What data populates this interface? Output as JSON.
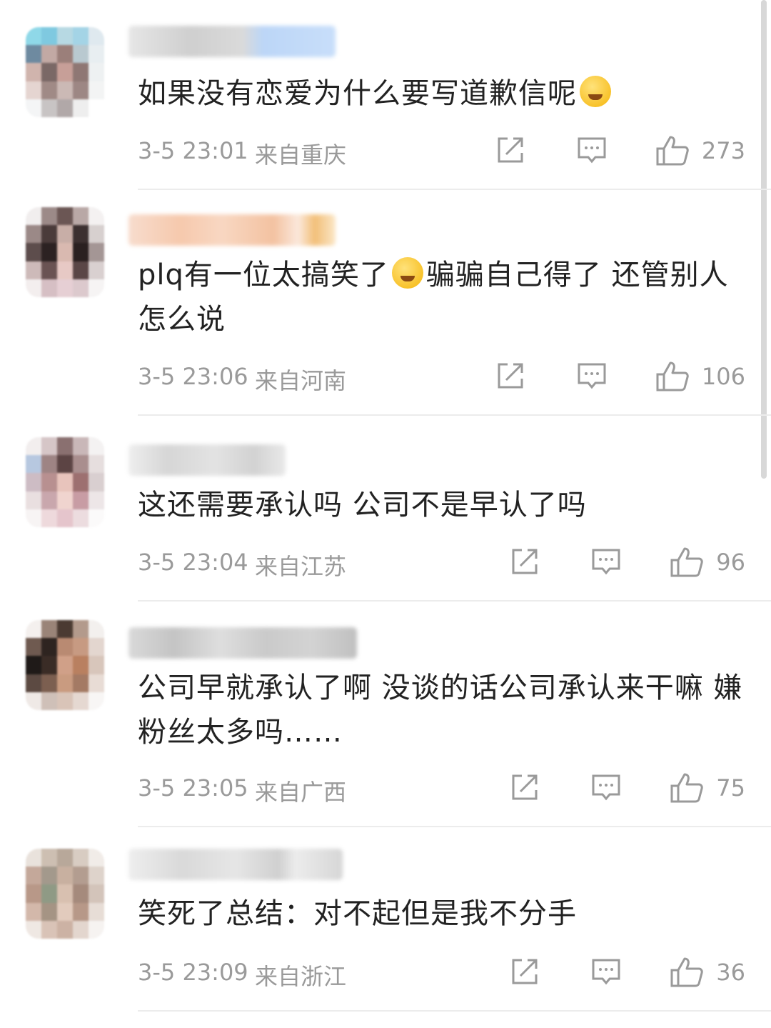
{
  "comments": [
    {
      "text": "如果没有恋爱为什么要写道歉信呢",
      "emoji_after": "tears-of-joy-emoji",
      "time": "3-5 23:01",
      "location": "来自重庆",
      "likes": "273"
    },
    {
      "text_part1": "plq有一位太搞笑了",
      "emoji_mid": "hand-over-mouth-emoji",
      "text_part2": "骗骗自己得了 还管别人怎么说",
      "time": "3-5 23:06",
      "location": "来自河南",
      "likes": "106"
    },
    {
      "text": "这还需要承认吗 公司不是早认了吗",
      "time": "3-5 23:04",
      "location": "来自江苏",
      "likes": "96"
    },
    {
      "text": "公司早就承认了啊 没谈的话公司承认来干嘛 嫌粉丝太多吗……",
      "time": "3-5 23:05",
      "location": "来自广西",
      "likes": "75"
    },
    {
      "text": "笑死了总结：对不起但是我不分手",
      "time": "3-5 23:09",
      "location": "来自浙江",
      "likes": "36"
    }
  ],
  "icons": {
    "share": "share-icon",
    "reply": "comment-icon",
    "like": "thumbs-up-icon"
  },
  "colors": {
    "text": "#222222",
    "meta": "#9a9a9a",
    "divider": "#ececec"
  }
}
